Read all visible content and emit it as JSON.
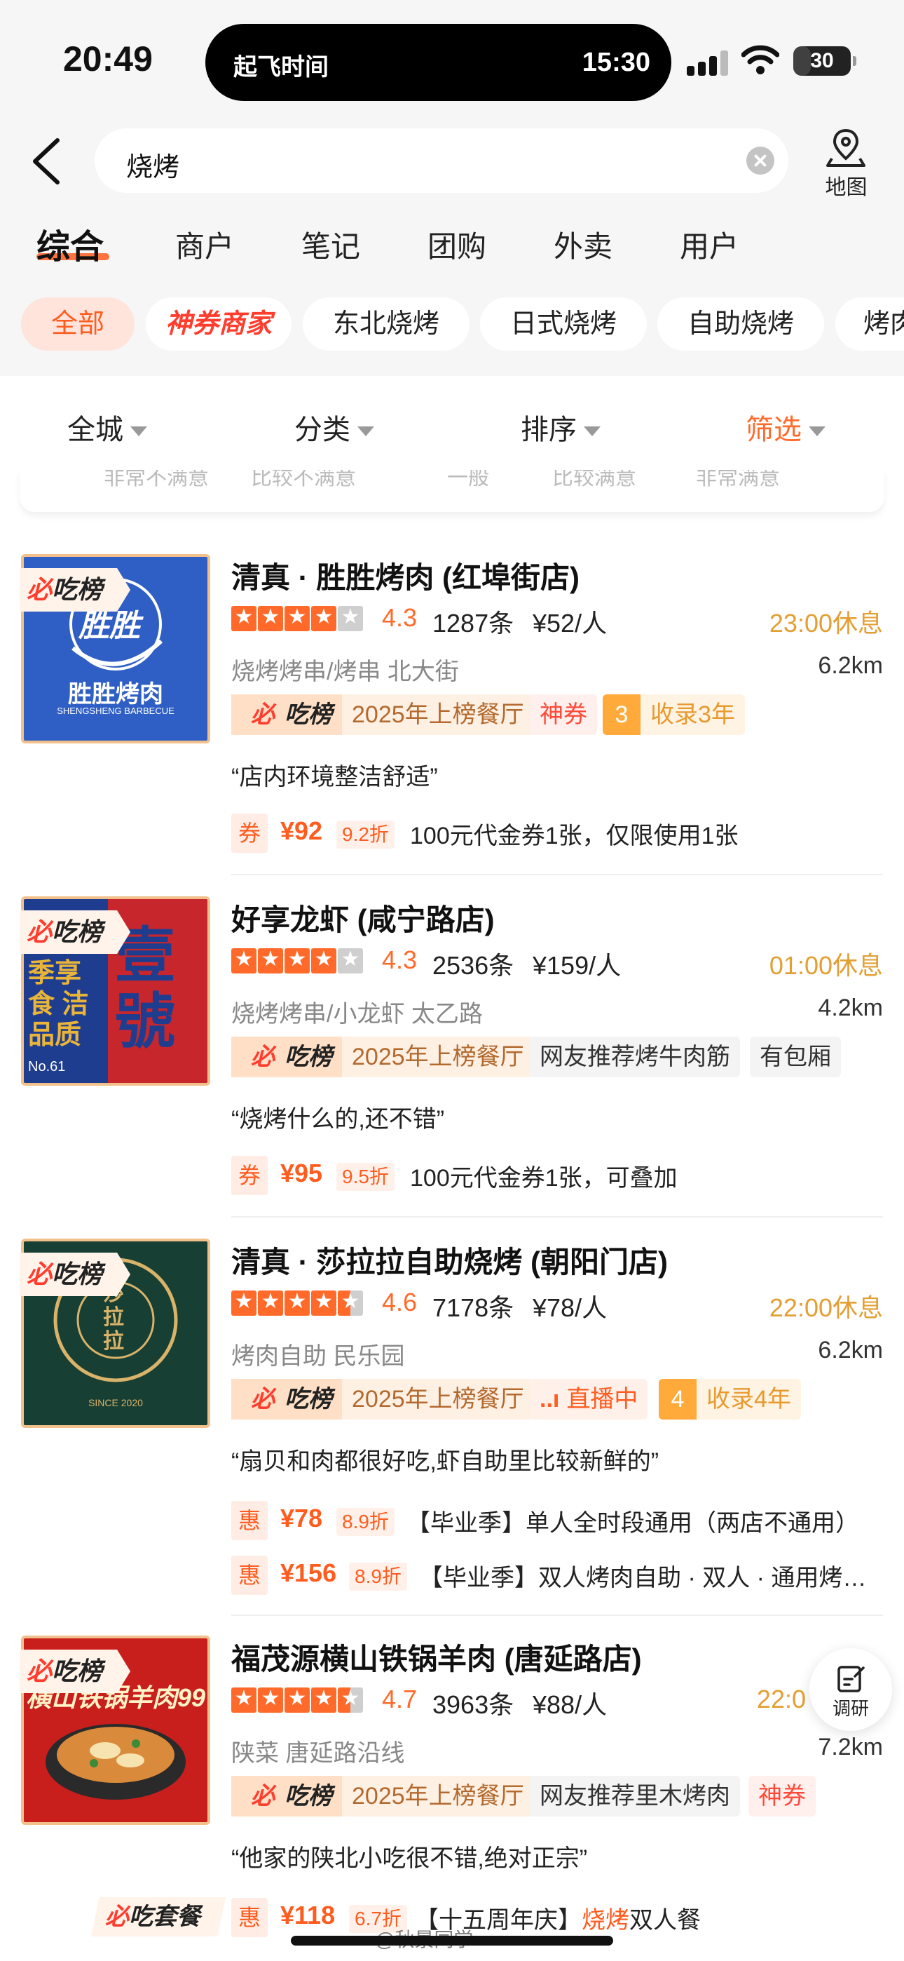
{
  "status_bar": {
    "time": "20:49",
    "island_label": "起飞时间",
    "island_time": "15:30",
    "battery": "30",
    "battery_level": 0.3
  },
  "search": {
    "query": "烧烤",
    "map_label": "地图"
  },
  "tabs": [
    {
      "label": "综合",
      "active": true
    },
    {
      "label": "商户"
    },
    {
      "label": "笔记"
    },
    {
      "label": "团购"
    },
    {
      "label": "外卖"
    },
    {
      "label": "用户"
    }
  ],
  "chips": [
    "全部",
    "神券商家",
    "东北烧烤",
    "日式烧烤",
    "自助烧烤",
    "烤肉"
  ],
  "filters": [
    "全城",
    "分类",
    "排序",
    "筛选"
  ],
  "hidden_strip": [
    "非常不满意",
    "比较不满意",
    "一般",
    "比较满意",
    "非常满意"
  ],
  "badge": {
    "prefix": "必",
    "name": "吃榜"
  },
  "items": [
    {
      "title": "清真 · 胜胜烤肉 (红埠街店)",
      "score": "4.3",
      "rating": 4.3,
      "reviews": "1287条",
      "price": "¥52/人",
      "hours": "23:00休息",
      "category": "烧烤烤串/烤串  北大街",
      "distance": "6.2km",
      "rank_tag": "2025年上榜餐厅",
      "tag2": "神券",
      "tag3_num": "3",
      "tag3": "收录3年",
      "quote": "“店内环境整洁舒适”",
      "thumb_brand": "胜胜烤肉",
      "thumb_sub": "SHENGSHENG BARBECUE",
      "thumb_logo": "胜胜",
      "deals": [
        {
          "icon": "券",
          "price": "¥92",
          "discount": "9.2折",
          "text": "100元代金券1张，仅限使用1张"
        }
      ]
    },
    {
      "title": "好享龙虾 (咸宁路店)",
      "score": "4.3",
      "rating": 4.3,
      "reviews": "2536条",
      "price": "¥159/人",
      "hours": "01:00休息",
      "category": "烧烤烤串/小龙虾  太乙路",
      "distance": "4.2km",
      "rank_tag": "2025年上榜餐厅",
      "tag2": "网友推荐烤牛肉筋",
      "tag3": "有包厢",
      "quote": "“烧烤什么的,还不错”",
      "thumb_text1": "壹",
      "thumb_text2": "號",
      "thumb_cols": "季享食 洁品质",
      "thumb_no": "No.61",
      "deals": [
        {
          "icon": "券",
          "price": "¥95",
          "discount": "9.5折",
          "text": "100元代金券1张，可叠加"
        }
      ]
    },
    {
      "title": "清真 · 莎拉拉自助烧烤 (朝阳门店)",
      "score": "4.6",
      "rating": 4.6,
      "reviews": "7178条",
      "price": "¥78/人",
      "hours": "22:00休息",
      "category": "烤肉自助  民乐园",
      "distance": "6.2km",
      "rank_tag": "2025年上榜餐厅",
      "tag2": "直播中",
      "tag3_num": "4",
      "tag3": "收录4年",
      "quote": "“扇贝和肉都很好吃,虾自助里比较新鲜的”",
      "thumb_logo": "莎拉拉",
      "thumb_since": "SINCE 2020",
      "deals": [
        {
          "icon": "惠",
          "price": "¥78",
          "discount": "8.9折",
          "text": "【毕业季】单人全时段通用（两店不通用）"
        },
        {
          "icon": "惠",
          "price": "¥156",
          "discount": "8.9折",
          "text": "【毕业季】双人烤肉自助 · 双人 · 通用烤…"
        }
      ]
    },
    {
      "title": "福茂源横山铁锅羊肉 (唐延路店)",
      "score": "4.7",
      "rating": 4.7,
      "reviews": "3963条",
      "price": "¥88/人",
      "hours": "22:0",
      "category": "陕菜  唐延路沿线",
      "distance": "7.2km",
      "rank_tag": "2025年上榜餐厅",
      "tag2": "网友推荐里木烤肉",
      "tag3": "神券",
      "quote": "“他家的陕北小吃很不错,绝对正宗”",
      "thumb_title": "横山铁锅羊肉99",
      "deals": [
        {
          "icon": "惠",
          "price": "¥118",
          "discount": "6.7折",
          "text_a": "【十五周年庆】",
          "text_hl": "烧烤",
          "text_b": "双人餐"
        }
      ]
    }
  ],
  "survey_label": "调研",
  "combo_tag": {
    "prefix": "必",
    "name": "吃套餐"
  },
  "watermark": "@秋景同学",
  "colors": {
    "accent": "#ff5c1f",
    "star": "#ff6a2a",
    "hours": "#e39f33",
    "brand_red": "#ff3d2e"
  }
}
